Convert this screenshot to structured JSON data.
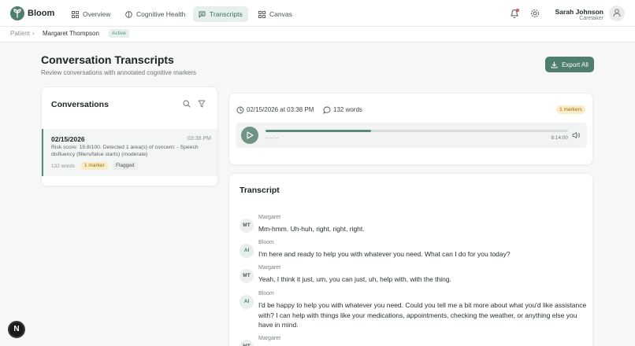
{
  "app": {
    "brand": "Bloom"
  },
  "nav": {
    "items": [
      {
        "label": "Overview",
        "icon": "grid-icon"
      },
      {
        "label": "Cognitive Health",
        "icon": "brain-icon"
      },
      {
        "label": "Transcripts",
        "icon": "message-square-icon",
        "active": true
      },
      {
        "label": "Canvas",
        "icon": "grid-icon"
      }
    ]
  },
  "user": {
    "name": "Sarah Johnson",
    "role": "Caretaker"
  },
  "breadcrumb": {
    "root": "Patient",
    "separator": "›",
    "current": "Margaret Thompson",
    "status": "Active"
  },
  "header": {
    "title": "Conversation Transcripts",
    "subtitle": "Review conversations with annotated cognitive markers",
    "export_label": "Export All"
  },
  "conversations": {
    "title": "Conversations",
    "items": [
      {
        "date": "02/15/2026",
        "time": "03:38 PM",
        "description": "Risk score: 19.8/100. Detected 1 area(s) of concern: - Speech disfluency (fillers/false starts) (moderate)",
        "words": "132 words",
        "marker_badge": "1 marker",
        "flag_badge": "Flagged"
      }
    ]
  },
  "player": {
    "datetime": "02/15/2026 at 03:38 PM",
    "words": "132 words",
    "markers": "1 markers",
    "current_time": "--:--:--",
    "duration": "8:14:00",
    "progress": 0.35
  },
  "transcript": {
    "title": "Transcript",
    "messages": [
      {
        "initials": "MT",
        "speaker": "Margaret",
        "text": "Mm-hmm. Uh-huh, right, right, right."
      },
      {
        "initials": "AI",
        "speaker": "Bloom",
        "text": "I'm here and ready to help you with whatever you need. What can I do for you today?"
      },
      {
        "initials": "MT",
        "speaker": "Margaret",
        "text": "Yeah, I think it just, um, you can just, uh, help with, with the thing."
      },
      {
        "initials": "AI",
        "speaker": "Bloom",
        "text": "I'd be happy to help you with whatever you need. Could you tell me a bit more about what you'd like assistance with? I can help with things like your medications, appointments, checking the weather, or anything else you have in mind."
      },
      {
        "initials": "MT",
        "speaker": "Margaret",
        "text": ""
      }
    ]
  },
  "fab": {
    "label": "N"
  },
  "colors": {
    "accent": "#4f7d6e",
    "marker_bg": "#fbecc8",
    "active_nav_bg": "#e6efe9"
  }
}
